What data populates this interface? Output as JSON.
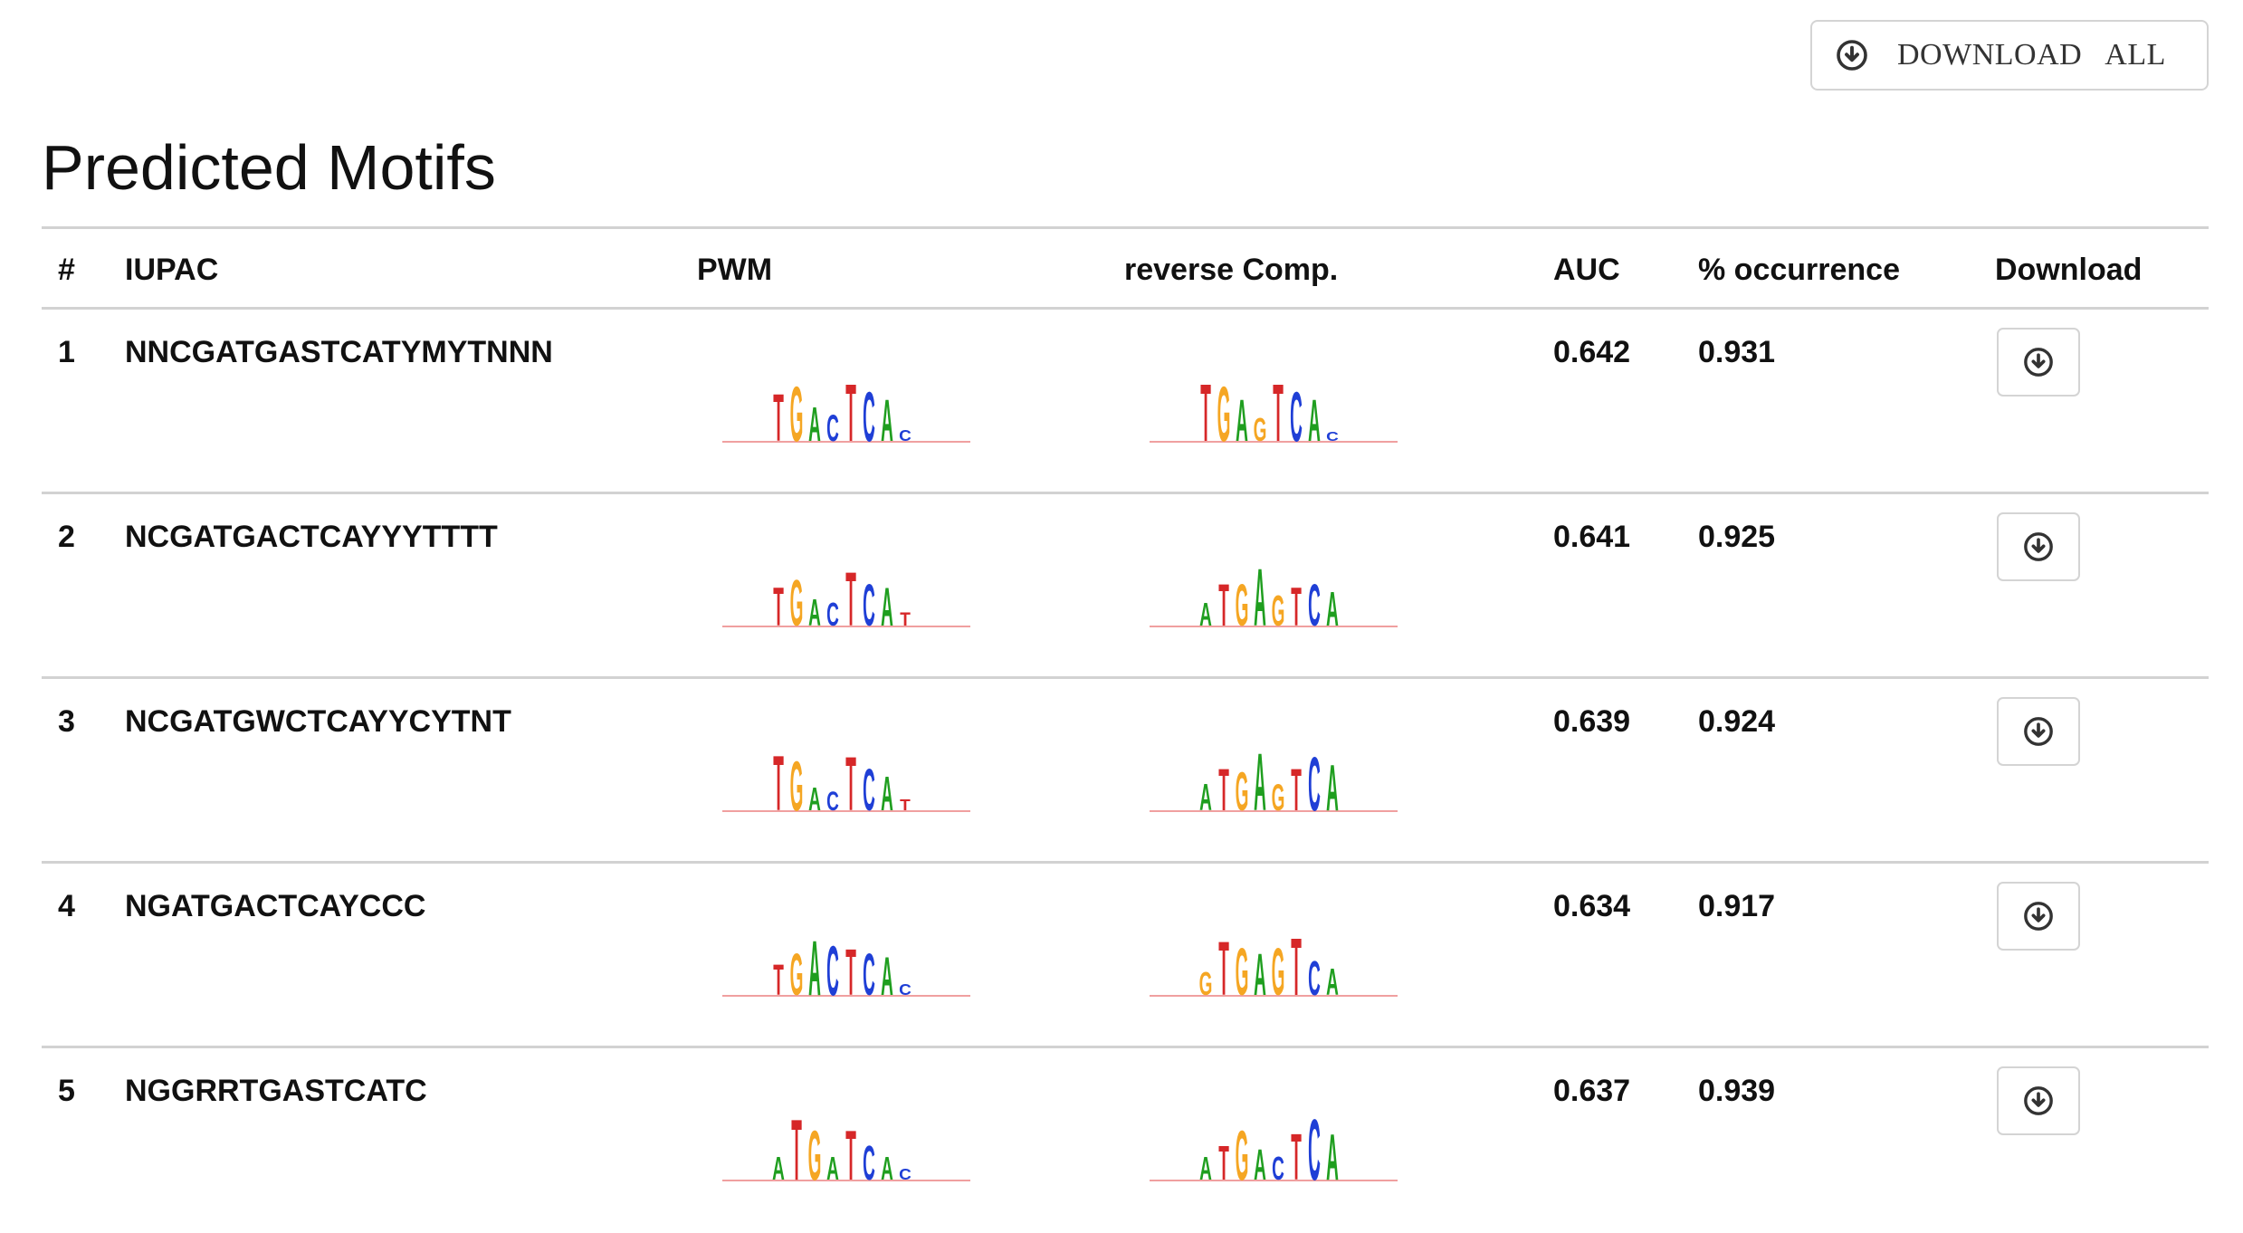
{
  "download_all": {
    "label": "DOWNLOAD ALL",
    "icon": "download-circle-icon"
  },
  "page_title": "Predicted Motifs",
  "table": {
    "headers": [
      "#",
      "IUPAC",
      "PWM",
      "reverse Comp.",
      "AUC",
      "% occurrence",
      "Download"
    ],
    "rows": [
      {
        "num": "1",
        "iupac": "NNCGATGASTCATYMYTNNN",
        "auc": "0.642",
        "occurrence": "0.931",
        "pwm": [
          [
            "T",
            0.62,
            "#d62728"
          ],
          [
            "G",
            0.72,
            "#f5a623"
          ],
          [
            "A",
            0.45,
            "#1f9e1f"
          ],
          [
            "C",
            0.35,
            "#1f3fd6"
          ],
          [
            "T",
            0.75,
            "#d62728"
          ],
          [
            "C",
            0.65,
            "#1f3fd6"
          ],
          [
            "A",
            0.55,
            "#1f9e1f"
          ],
          [
            "C",
            0.15,
            "#1f3fd6"
          ]
        ],
        "rev": [
          [
            "T",
            0.75,
            "#d62728"
          ],
          [
            "G",
            0.72,
            "#f5a623"
          ],
          [
            "A",
            0.55,
            "#1f9e1f"
          ],
          [
            "G",
            0.3,
            "#f5a623"
          ],
          [
            "T",
            0.75,
            "#d62728"
          ],
          [
            "C",
            0.65,
            "#1f3fd6"
          ],
          [
            "A",
            0.55,
            "#1f9e1f"
          ],
          [
            "C",
            0.12,
            "#1f3fd6"
          ]
        ]
      },
      {
        "num": "2",
        "iupac": "NCGATGACTCAYYYTTTT",
        "auc": "0.641",
        "occurrence": "0.925",
        "pwm": [
          [
            "T",
            0.5,
            "#d62728"
          ],
          [
            "G",
            0.6,
            "#f5a623"
          ],
          [
            "A",
            0.35,
            "#1f9e1f"
          ],
          [
            "C",
            0.3,
            "#1f3fd6"
          ],
          [
            "T",
            0.7,
            "#d62728"
          ],
          [
            "C",
            0.55,
            "#1f3fd6"
          ],
          [
            "A",
            0.5,
            "#1f9e1f"
          ],
          [
            "T",
            0.18,
            "#d62728"
          ]
        ],
        "rev": [
          [
            "A",
            0.3,
            "#1f9e1f"
          ],
          [
            "T",
            0.55,
            "#d62728"
          ],
          [
            "G",
            0.55,
            "#f5a623"
          ],
          [
            "A",
            0.75,
            "#1f9e1f"
          ],
          [
            "G",
            0.4,
            "#f5a623"
          ],
          [
            "T",
            0.5,
            "#d62728"
          ],
          [
            "C",
            0.55,
            "#1f3fd6"
          ],
          [
            "A",
            0.45,
            "#1f9e1f"
          ]
        ]
      },
      {
        "num": "3",
        "iupac": "NCGATGWCTCAYYCYTNT",
        "auc": "0.639",
        "occurrence": "0.924",
        "pwm": [
          [
            "T",
            0.72,
            "#d62728"
          ],
          [
            "G",
            0.65,
            "#f5a623"
          ],
          [
            "A",
            0.3,
            "#1f9e1f"
          ],
          [
            "C",
            0.25,
            "#1f3fd6"
          ],
          [
            "T",
            0.7,
            "#d62728"
          ],
          [
            "C",
            0.55,
            "#1f3fd6"
          ],
          [
            "A",
            0.45,
            "#1f9e1f"
          ],
          [
            "T",
            0.15,
            "#d62728"
          ]
        ],
        "rev": [
          [
            "A",
            0.35,
            "#1f9e1f"
          ],
          [
            "T",
            0.55,
            "#d62728"
          ],
          [
            "G",
            0.5,
            "#f5a623"
          ],
          [
            "A",
            0.75,
            "#1f9e1f"
          ],
          [
            "G",
            0.35,
            "#f5a623"
          ],
          [
            "T",
            0.55,
            "#d62728"
          ],
          [
            "C",
            0.7,
            "#1f3fd6"
          ],
          [
            "A",
            0.6,
            "#1f9e1f"
          ]
        ]
      },
      {
        "num": "4",
        "iupac": "NGATGACTCAYCCC",
        "auc": "0.634",
        "occurrence": "0.917",
        "pwm": [
          [
            "T",
            0.4,
            "#d62728"
          ],
          [
            "G",
            0.55,
            "#f5a623"
          ],
          [
            "A",
            0.72,
            "#1f9e1f"
          ],
          [
            "C",
            0.65,
            "#1f3fd6"
          ],
          [
            "T",
            0.6,
            "#d62728"
          ],
          [
            "C",
            0.55,
            "#1f3fd6"
          ],
          [
            "A",
            0.5,
            "#1f9e1f"
          ],
          [
            "C",
            0.15,
            "#1f3fd6"
          ]
        ],
        "rev": [
          [
            "G",
            0.3,
            "#f5a623"
          ],
          [
            "T",
            0.7,
            "#d62728"
          ],
          [
            "G",
            0.62,
            "#f5a623"
          ],
          [
            "A",
            0.55,
            "#1f9e1f"
          ],
          [
            "G",
            0.62,
            "#f5a623"
          ],
          [
            "T",
            0.75,
            "#d62728"
          ],
          [
            "C",
            0.45,
            "#1f3fd6"
          ],
          [
            "A",
            0.35,
            "#1f9e1f"
          ]
        ]
      },
      {
        "num": "5",
        "iupac": "NGGRRTGASTCATC",
        "auc": "0.637",
        "occurrence": "0.939",
        "pwm": [
          [
            "A",
            0.3,
            "#1f9e1f"
          ],
          [
            "T",
            0.8,
            "#d62728"
          ],
          [
            "G",
            0.65,
            "#f5a623"
          ],
          [
            "A",
            0.3,
            "#1f9e1f"
          ],
          [
            "T",
            0.65,
            "#d62728"
          ],
          [
            "C",
            0.45,
            "#1f3fd6"
          ],
          [
            "A",
            0.3,
            "#1f9e1f"
          ],
          [
            "C",
            0.15,
            "#1f3fd6"
          ]
        ],
        "rev": [
          [
            "A",
            0.3,
            "#1f9e1f"
          ],
          [
            "T",
            0.45,
            "#d62728"
          ],
          [
            "G",
            0.65,
            "#f5a623"
          ],
          [
            "A",
            0.4,
            "#1f9e1f"
          ],
          [
            "C",
            0.3,
            "#1f3fd6"
          ],
          [
            "T",
            0.6,
            "#d62728"
          ],
          [
            "C",
            0.8,
            "#1f3fd6"
          ],
          [
            "A",
            0.6,
            "#1f9e1f"
          ]
        ]
      }
    ]
  }
}
